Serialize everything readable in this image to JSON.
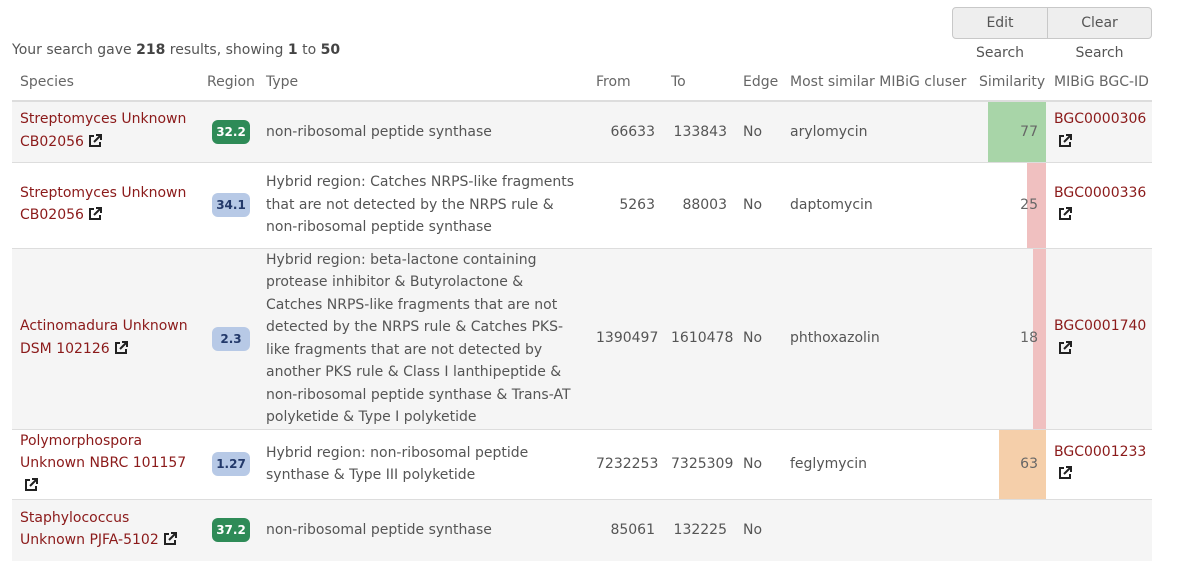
{
  "buttons": {
    "edit": "Edit Search",
    "clear": "Clear Search"
  },
  "summary": {
    "prefix": "Your search gave",
    "total": "218",
    "mid": "results, showing",
    "from": "1",
    "to_word": "to",
    "to": "50"
  },
  "columns": [
    "Species",
    "Region",
    "Type",
    "From",
    "To",
    "Edge",
    "Most similar MIBiG cluser",
    "Similarity",
    "MIBiG BGC-ID"
  ],
  "rows": [
    {
      "species": "Streptomyces Unknown CB02056",
      "region": "32.2",
      "type": "non-ribosomal peptide synthase",
      "from": "66633",
      "to": "133843",
      "edge": "No",
      "mibig": "arylomycin",
      "similarity": "77",
      "bgc": "BGC0000306"
    },
    {
      "species": "Streptomyces Unknown CB02056",
      "region": "34.1",
      "type": "Hybrid region: Catches NRPS-like fragments that are not detected by the NRPS rule & non-ribosomal peptide synthase",
      "from": "5263",
      "to": "88003",
      "edge": "No",
      "mibig": "daptomycin",
      "similarity": "25",
      "bgc": "BGC0000336"
    },
    {
      "species": "Actinomadura Unknown DSM 102126",
      "region": "2.3",
      "type": "Hybrid region: beta-lactone containing protease inhibitor & Butyrolactone & Catches NRPS-like fragments that are not detected by the NRPS rule & Catches PKS-like fragments that are not detected by another PKS rule & Class I lanthipeptide & non-ribosomal peptide synthase & Trans-AT polyketide & Type I polyketide",
      "from": "1390497",
      "to": "1610478",
      "edge": "No",
      "mibig": "phthoxazolin",
      "similarity": "18",
      "bgc": "BGC0001740"
    },
    {
      "species": "Polymorphospora Unknown NBRC 101157",
      "region": "1.27",
      "type": "Hybrid region: non-ribosomal peptide synthase & Type III polyketide",
      "from": "7232253",
      "to": "7325309",
      "edge": "No",
      "mibig": "feglymycin",
      "similarity": "63",
      "bgc": "BGC0001233"
    },
    {
      "species": "Staphylococcus Unknown PJFA-5102",
      "region": "37.2",
      "type": "non-ribosomal peptide synthase",
      "from": "85061",
      "to": "132225",
      "edge": "No",
      "mibig": "",
      "similarity": "",
      "bgc": ""
    }
  ],
  "colors": {
    "badge_green": "#2e8b57",
    "badge_blue": "#b7c9e6",
    "sim_high": "#a8d5a8",
    "sim_low": "#f0c0c0",
    "sim_mid": "#f5cfaa",
    "link": "#8b1a1a"
  },
  "icons": {
    "external_link": "external-link-icon"
  }
}
